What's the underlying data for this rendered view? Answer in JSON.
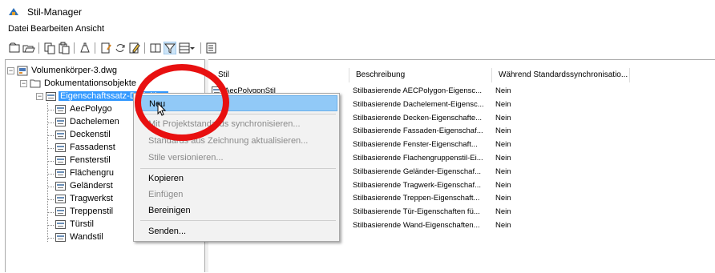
{
  "window": {
    "title": "Stil-Manager"
  },
  "menu": [
    "Datei",
    "Bearbeiten",
    "Ansicht"
  ],
  "toolbar_icons": [
    "new-drawing-icon",
    "open-drawing-icon",
    "copy-icon",
    "paste-icon",
    "purge-icon",
    "edit-icon",
    "synchronize-icon",
    "notes-icon",
    "version-icon",
    "filter-icon",
    "view-mode-icon",
    "dropdown-arrow-icon",
    "toggle-view-icon"
  ],
  "tree": {
    "file": "Volumenkörper-3.dwg",
    "folder": "Dokumentationsobjekte",
    "selected": "Eigenschaftssatz-Definition",
    "children": [
      "AecPolygo",
      "Dachelemen",
      "Deckenstil",
      "Fassadenst",
      "Fensterstil",
      "Flächengru",
      "Geländerst",
      "Tragwerkst",
      "Treppenstil",
      "Türstil",
      "Wandstil"
    ]
  },
  "list": {
    "columns": [
      "Stil",
      "Beschreibung",
      "Während Standardssynchronisatio..."
    ],
    "rows": [
      [
        "AecPolygonStil",
        "Stilbasierende AECPolygon-Eigensc...",
        "Nein"
      ],
      [
        "",
        "Stilbasierende Dachelement-Eigensc...",
        "Nein"
      ],
      [
        "",
        "Stilbasierende Decken-Eigenschafte...",
        "Nein"
      ],
      [
        "",
        "Stilbasierende Fassaden-Eigenschaf...",
        "Nein"
      ],
      [
        "",
        "Stilbasierende Fenster-Eigenschaft...",
        "Nein"
      ],
      [
        "",
        "Stilbasierende Flachengruppenstil-Ei...",
        "Nein"
      ],
      [
        "",
        "Stilbasierende Geländer-Eigenschaf...",
        "Nein"
      ],
      [
        "",
        "Stilbasierende Tragwerk-Eigenschaf...",
        "Nein"
      ],
      [
        "",
        "Stilbasierende Treppen-Eigenschaft...",
        "Nein"
      ],
      [
        "",
        "Stilbasierende Tür-Eigenschaften fü...",
        "Nein"
      ],
      [
        "",
        "Stilbasierende Wand-Eigenschaften...",
        "Nein"
      ]
    ]
  },
  "context_menu": {
    "new": "Neu",
    "sync": "Mit Projektstandards synchronisieren...",
    "update": "Standards aus Zeichnung aktualisieren...",
    "versions": "Stile versionieren...",
    "copy": "Kopieren",
    "paste": "Einfügen",
    "purge": "Bereinigen",
    "send": "Senden..."
  },
  "colors": {
    "selection": "#3399ff",
    "menu_highlight": "#91c9f7",
    "annotation": "#e81010"
  }
}
